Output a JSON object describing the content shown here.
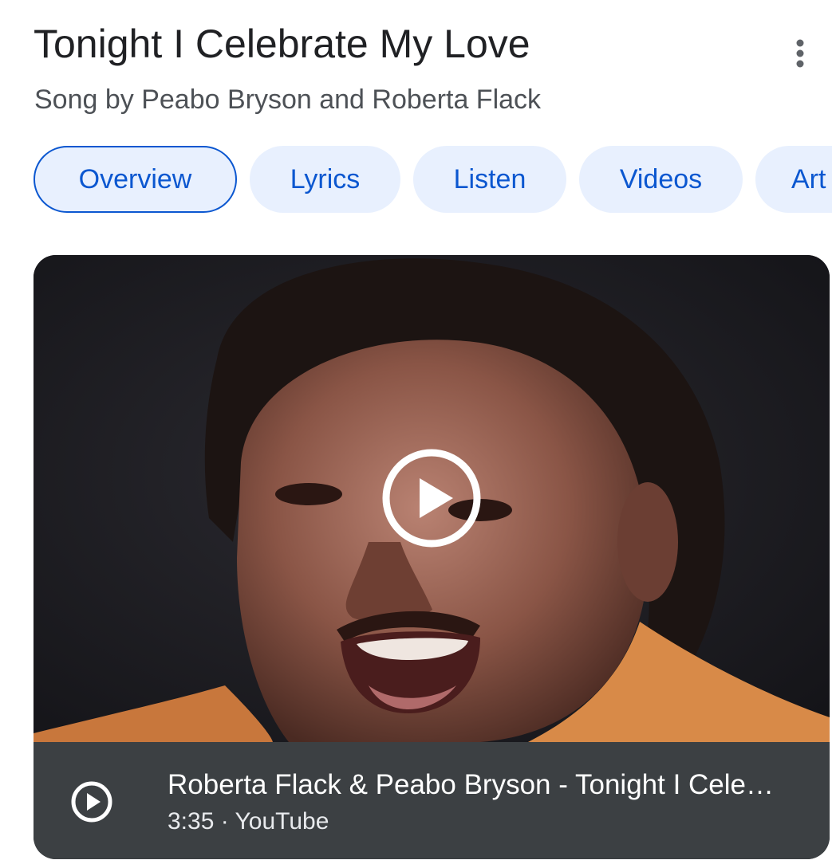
{
  "header": {
    "title": "Tonight I Celebrate My Love",
    "subtitle": "Song by Peabo Bryson and Roberta Flack",
    "more_icon": "more-vert-icon"
  },
  "tabs": [
    {
      "label": "Overview",
      "active": true
    },
    {
      "label": "Lyrics",
      "active": false
    },
    {
      "label": "Listen",
      "active": false
    },
    {
      "label": "Videos",
      "active": false
    },
    {
      "label": "Art",
      "active": false
    }
  ],
  "video": {
    "title": "Roberta Flack & Peabo Bryson - Tonight I Cele…",
    "duration": "3:35",
    "separator": " · ",
    "source": "YouTube",
    "play_icon": "play-circle-icon"
  },
  "colors": {
    "accent": "#0b57d0",
    "chip_bg": "#e8f0fe",
    "info_bar": "#3c4043"
  }
}
